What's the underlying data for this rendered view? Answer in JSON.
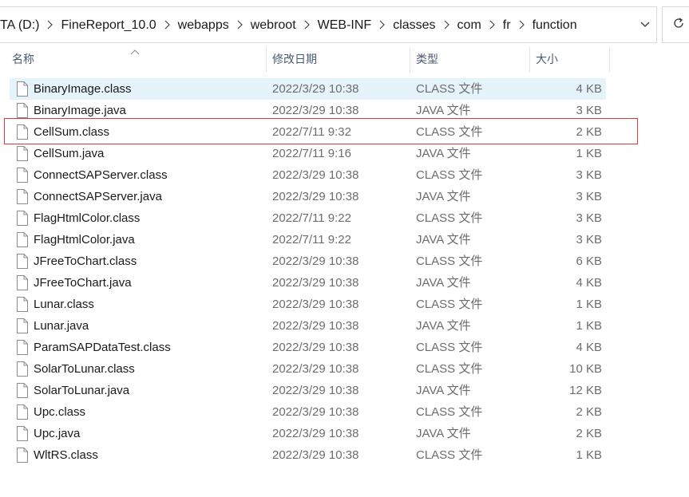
{
  "breadcrumb": [
    "TA (D:)",
    "FineReport_10.0",
    "webapps",
    "webroot",
    "WEB-INF",
    "classes",
    "com",
    "fr",
    "function"
  ],
  "columns": {
    "name": "名称",
    "date": "修改日期",
    "type": "类型",
    "size": "大小"
  },
  "icons": {
    "file": "file-icon",
    "dropdown": "chevron-down-icon",
    "refresh": "refresh-icon",
    "sort": "sort-up-icon"
  },
  "files": [
    {
      "name": "BinaryImage.class",
      "date": "2022/3/29 10:38",
      "type": "CLASS 文件",
      "size": "4 KB"
    },
    {
      "name": "BinaryImage.java",
      "date": "2022/3/29 10:38",
      "type": "JAVA 文件",
      "size": "3 KB"
    },
    {
      "name": "CellSum.class",
      "date": "2022/7/11 9:32",
      "type": "CLASS 文件",
      "size": "2 KB"
    },
    {
      "name": "CellSum.java",
      "date": "2022/7/11 9:16",
      "type": "JAVA 文件",
      "size": "1 KB"
    },
    {
      "name": "ConnectSAPServer.class",
      "date": "2022/3/29 10:38",
      "type": "CLASS 文件",
      "size": "3 KB"
    },
    {
      "name": "ConnectSAPServer.java",
      "date": "2022/3/29 10:38",
      "type": "JAVA 文件",
      "size": "3 KB"
    },
    {
      "name": "FlagHtmlColor.class",
      "date": "2022/7/11 9:22",
      "type": "CLASS 文件",
      "size": "3 KB"
    },
    {
      "name": "FlagHtmlColor.java",
      "date": "2022/7/11 9:22",
      "type": "JAVA 文件",
      "size": "3 KB"
    },
    {
      "name": "JFreeToChart.class",
      "date": "2022/3/29 10:38",
      "type": "CLASS 文件",
      "size": "6 KB"
    },
    {
      "name": "JFreeToChart.java",
      "date": "2022/3/29 10:38",
      "type": "JAVA 文件",
      "size": "4 KB"
    },
    {
      "name": "Lunar.class",
      "date": "2022/3/29 10:38",
      "type": "CLASS 文件",
      "size": "1 KB"
    },
    {
      "name": "Lunar.java",
      "date": "2022/3/29 10:38",
      "type": "JAVA 文件",
      "size": "1 KB"
    },
    {
      "name": "ParamSAPDataTest.class",
      "date": "2022/3/29 10:38",
      "type": "CLASS 文件",
      "size": "4 KB"
    },
    {
      "name": "SolarToLunar.class",
      "date": "2022/3/29 10:38",
      "type": "CLASS 文件",
      "size": "10 KB"
    },
    {
      "name": "SolarToLunar.java",
      "date": "2022/3/29 10:38",
      "type": "JAVA 文件",
      "size": "12 KB"
    },
    {
      "name": "Upc.class",
      "date": "2022/3/29 10:38",
      "type": "CLASS 文件",
      "size": "2 KB"
    },
    {
      "name": "Upc.java",
      "date": "2022/3/29 10:38",
      "type": "JAVA 文件",
      "size": "2 KB"
    },
    {
      "name": "WltRS.class",
      "date": "2022/3/29 10:38",
      "type": "CLASS 文件",
      "size": "1 KB"
    }
  ],
  "hovered_row": 0,
  "highlighted_row": 2,
  "colors": {
    "hover": "#e5f3fb",
    "highlight_border": "#e0393e"
  }
}
